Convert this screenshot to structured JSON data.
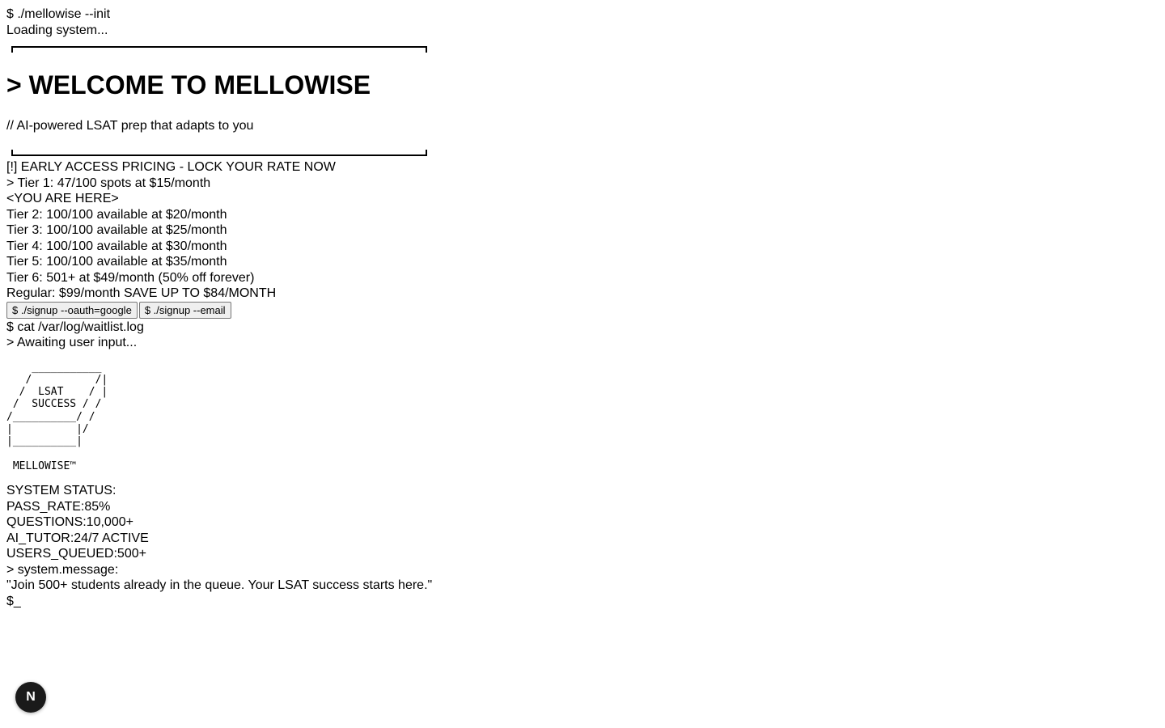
{
  "terminal": {
    "init_command": "$ ./mellowise --init",
    "loading": "Loading system...",
    "headline": "> WELCOME TO MELLOWISE",
    "tagline": "// AI-powered LSAT prep that adapts to you"
  },
  "pricing": {
    "notice": "[!] EARLY ACCESS PRICING - LOCK YOUR RATE NOW",
    "tiers": [
      "> Tier 1: 47/100 spots at $15/month",
      "<YOU ARE HERE>",
      "Tier 2: 100/100 available at $20/month",
      "Tier 3: 100/100 available at $25/month",
      "Tier 4: 100/100 available at $30/month",
      "Tier 5: 100/100 available at $35/month",
      "Tier 6: 501+ at $49/month (50% off forever)",
      "Regular: $99/month SAVE UP TO $84/MONTH"
    ]
  },
  "signup": {
    "google_label": "$ ./signup --oauth=google",
    "email_label": "$ ./signup --email"
  },
  "waitlist": {
    "command": "$ cat /var/log/waitlist.log",
    "awaiting": "> Awaiting user input..."
  },
  "ascii_art": "    ___________\n   /          /|\n  /  LSAT    / |\n /  SUCCESS / /\n/__________/ /\n|          |/\n|__________|\n\n MELLOWISE™",
  "status": {
    "header": "SYSTEM STATUS:",
    "pass_rate": "PASS_RATE:85%",
    "questions": "QUESTIONS:10,000+",
    "ai_tutor": "AI_TUTOR:24/7 ACTIVE",
    "users_queued": "USERS_QUEUED:500+"
  },
  "message": {
    "label": "> system.message:",
    "text": "\"Join 500+ students already in the queue. Your LSAT success starts here.\"",
    "prompt": "$_"
  },
  "badge": {
    "letter": "N",
    "icon": "nextjs-logo-icon"
  }
}
